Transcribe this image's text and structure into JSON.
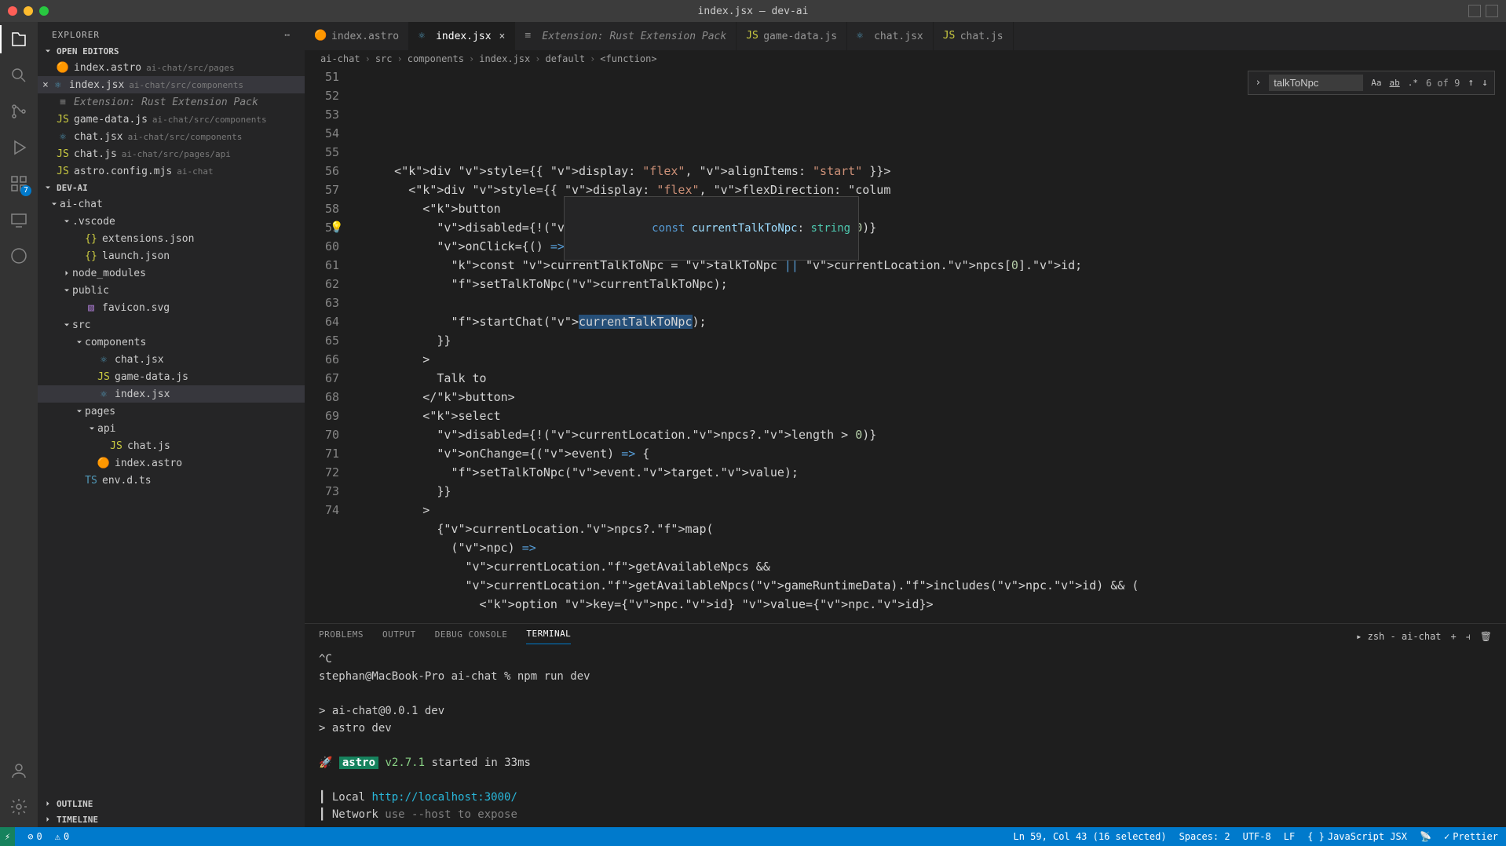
{
  "window": {
    "title": "index.jsx — dev-ai"
  },
  "explorer": {
    "title": "EXPLORER",
    "sections": {
      "openEditors": "OPEN EDITORS",
      "project": "DEV-AI",
      "outline": "OUTLINE",
      "timeline": "TIMELINE"
    },
    "openEditors": [
      {
        "name": "index.astro",
        "hint": "ai-chat/src/pages",
        "icon": "astro"
      },
      {
        "name": "index.jsx",
        "hint": "ai-chat/src/components",
        "icon": "jsx",
        "active": true
      },
      {
        "name": "Extension: Rust Extension Pack",
        "icon": "ext",
        "dim": true
      },
      {
        "name": "game-data.js",
        "hint": "ai-chat/src/components",
        "icon": "js"
      },
      {
        "name": "chat.jsx",
        "hint": "ai-chat/src/components",
        "icon": "jsx"
      },
      {
        "name": "chat.js",
        "hint": "ai-chat/src/pages/api",
        "icon": "js"
      },
      {
        "name": "astro.config.mjs",
        "hint": "ai-chat",
        "icon": "js"
      }
    ],
    "tree": [
      {
        "name": "ai-chat",
        "type": "folder",
        "depth": 0,
        "open": true
      },
      {
        "name": ".vscode",
        "type": "folder",
        "depth": 1,
        "open": true
      },
      {
        "name": "extensions.json",
        "type": "file",
        "icon": "json",
        "depth": 2
      },
      {
        "name": "launch.json",
        "type": "file",
        "icon": "json",
        "depth": 2
      },
      {
        "name": "node_modules",
        "type": "folder",
        "depth": 1,
        "open": false
      },
      {
        "name": "public",
        "type": "folder",
        "depth": 1,
        "open": true
      },
      {
        "name": "favicon.svg",
        "type": "file",
        "icon": "svg",
        "depth": 2
      },
      {
        "name": "src",
        "type": "folder",
        "depth": 1,
        "open": true
      },
      {
        "name": "components",
        "type": "folder",
        "depth": 2,
        "open": true
      },
      {
        "name": "chat.jsx",
        "type": "file",
        "icon": "jsx",
        "depth": 3
      },
      {
        "name": "game-data.js",
        "type": "file",
        "icon": "js",
        "depth": 3
      },
      {
        "name": "index.jsx",
        "type": "file",
        "icon": "jsx",
        "depth": 3,
        "sel": true
      },
      {
        "name": "pages",
        "type": "folder",
        "depth": 2,
        "open": true
      },
      {
        "name": "api",
        "type": "folder",
        "depth": 3,
        "open": true
      },
      {
        "name": "chat.js",
        "type": "file",
        "icon": "js",
        "depth": 4
      },
      {
        "name": "index.astro",
        "type": "file",
        "icon": "astro",
        "depth": 3
      },
      {
        "name": "env.d.ts",
        "type": "file",
        "icon": "ts",
        "depth": 2
      }
    ]
  },
  "tabs": [
    {
      "label": "index.astro",
      "icon": "astro"
    },
    {
      "label": "index.jsx",
      "icon": "jsx",
      "active": true,
      "close": true
    },
    {
      "label": "Extension: Rust Extension Pack",
      "icon": "ext",
      "dim": true
    },
    {
      "label": "game-data.js",
      "icon": "js"
    },
    {
      "label": "chat.jsx",
      "icon": "jsx"
    },
    {
      "label": "chat.js",
      "icon": "js"
    }
  ],
  "breadcrumbs": [
    "ai-chat",
    "src",
    "components",
    "index.jsx",
    "default",
    "<function>"
  ],
  "find": {
    "term": "talkToNpc",
    "count": "6 of 9"
  },
  "code": {
    "startLine": 51,
    "lines": [
      "      <div style={{ display: \"flex\", alignItems: \"start\" }}>",
      "        <div style={{ display: \"flex\", flexDirection: \"colum",
      "          <button",
      "            disabled={!(currentLocation.npcs?.length > 0)}",
      "            onClick={() => {",
      "              const currentTalkToNpc = talkToNpc || currentLocation.npcs[0].id;",
      "              setTalkToNpc(currentTalkToNpc);",
      "",
      "              startChat(currentTalkToNpc);",
      "            }}",
      "          >",
      "            Talk to",
      "          </button>",
      "          <select",
      "            disabled={!(currentLocation.npcs?.length > 0)}",
      "            onChange={(event) => {",
      "              setTalkToNpc(event.target.value);",
      "            }}",
      "          >",
      "            {currentLocation.npcs?.map(",
      "              (npc) =>",
      "                currentLocation.getAvailableNpcs &&",
      "                currentLocation.getAvailableNpcs(gameRuntimeData).includes(npc.id) && (",
      "                  <option key={npc.id} value={npc.id}>"
    ]
  },
  "hover": {
    "text": "const currentTalkToNpc: string"
  },
  "panel": {
    "tabs": [
      "PROBLEMS",
      "OUTPUT",
      "DEBUG CONSOLE",
      "TERMINAL"
    ],
    "active": "TERMINAL",
    "shell": "zsh - ai-chat",
    "lines": [
      {
        "t": "^C",
        "cls": ""
      },
      {
        "t": "stephan@MacBook-Pro ai-chat % npm run dev",
        "cls": ""
      },
      {
        "t": "",
        "cls": ""
      },
      {
        "t": "> ai-chat@0.0.1 dev",
        "cls": ""
      },
      {
        "t": "> astro dev",
        "cls": ""
      },
      {
        "t": "",
        "cls": ""
      },
      {
        "t": "  🚀  astro  v2.7.1 started in 33ms",
        "cls": "astro"
      },
      {
        "t": "",
        "cls": ""
      },
      {
        "t": "  ┃ Local    http://localhost:3000/",
        "cls": "local"
      },
      {
        "t": "  ┃ Network  use --host to expose",
        "cls": "net"
      }
    ]
  },
  "status": {
    "remote": "",
    "errors": "0",
    "warnings": "0",
    "position": "Ln 59, Col 43 (16 selected)",
    "spaces": "Spaces: 2",
    "encoding": "UTF-8",
    "eol": "LF",
    "lang": "JavaScript JSX",
    "prettier": "Prettier"
  },
  "activity": {
    "extBadge": "7"
  }
}
